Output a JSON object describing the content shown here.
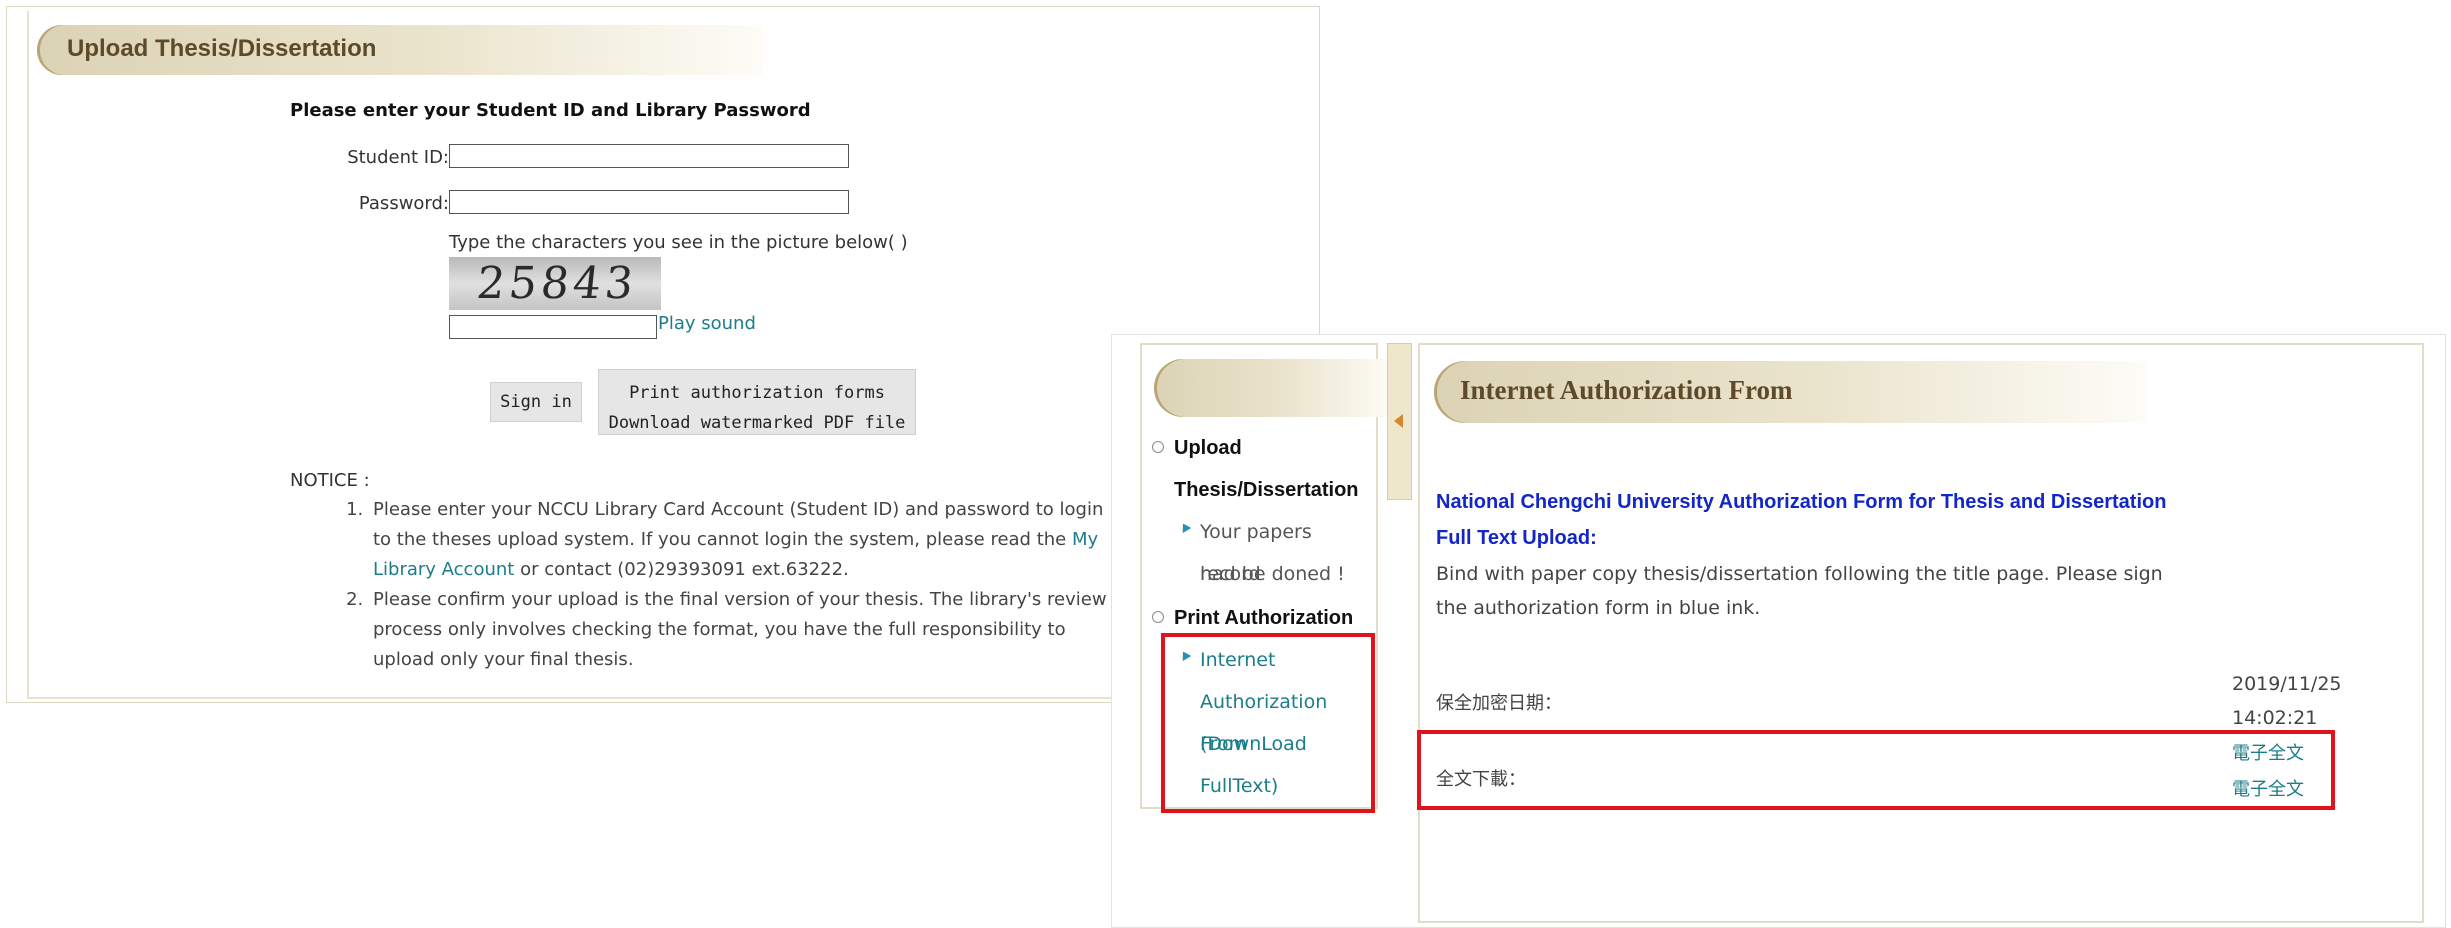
{
  "upload": {
    "title": "Upload Thesis/Dissertation",
    "login_heading": "Please enter your Student ID and Library Password",
    "student_id_label": "Student ID:",
    "password_label": "Password:",
    "captcha_prompt": "Type the characters you see in the picture below( )",
    "captcha_text": "25843",
    "play_sound": "Play sound",
    "signin_label": "Sign in",
    "print_forms_label": "Print authorization forms",
    "download_pdf_label": "Download watermarked PDF file",
    "notice_label": "NOTICE :",
    "notice_1_before": "Please enter your NCCU Library Card Account (Student ID) and password to login to the theses upload system. If you cannot login the system, please read the ",
    "notice_1_link": "My Library Account",
    "notice_1_after": " or contact (02)29393091 ext.63222.",
    "notice_2": "Please confirm your upload is the final version of your thesis. The library's review process only involves checking the format, you have the full responsibility to upload only your final thesis."
  },
  "sidebar": {
    "section_upload_line1": "Upload",
    "section_upload_line2": "Thesis/Dissertation",
    "upload_item_line1": "Your papers record",
    "upload_item_line2": "had be doned !",
    "section_print": "Print Authorization",
    "print_item_line1": "Internet",
    "print_item_line2": "Authorization From",
    "print_item_line3": "(DownLoad",
    "print_item_line4": "FullText)"
  },
  "content": {
    "title": "Internet Authorization From",
    "form_title": "National Chengchi University Authorization Form for Thesis and Dissertation",
    "fulltext_upload": "Full Text Upload:",
    "bind_text": "Bind with paper copy thesis/dissertation following the title page. Please sign the authorization form in blue ink.",
    "date_label": "保全加密日期：",
    "date_value_line1": "2019/11/25",
    "date_value_line2": "14:02:21",
    "download_label": "全文下載：",
    "download_link_1": "電子全文",
    "download_link_2": "電子全文"
  },
  "colors": {
    "highlight_box": "#e0121d",
    "link": "#1c7d8a",
    "form_title": "#1326c9",
    "header_tab": "#dcd3b5"
  }
}
